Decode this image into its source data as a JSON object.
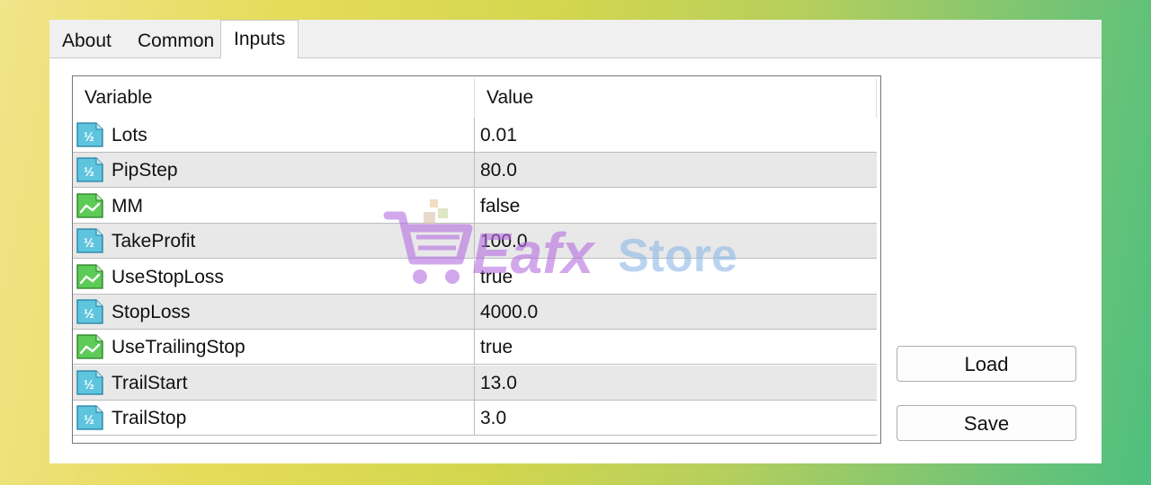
{
  "tabs": [
    {
      "label": "About"
    },
    {
      "label": "Common"
    },
    {
      "label": "Inputs"
    }
  ],
  "columns": {
    "variable": "Variable",
    "value": "Value"
  },
  "rows": [
    {
      "name": "Lots",
      "value": "0.01",
      "icon": "numeric-value-icon"
    },
    {
      "name": "PipStep",
      "value": "80.0",
      "icon": "numeric-value-icon"
    },
    {
      "name": "MM",
      "value": "false",
      "icon": "boolean-value-icon"
    },
    {
      "name": "TakeProfit",
      "value": "100.0",
      "icon": "numeric-value-icon"
    },
    {
      "name": "UseStopLoss",
      "value": "true",
      "icon": "boolean-value-icon"
    },
    {
      "name": "StopLoss",
      "value": "4000.0",
      "icon": "numeric-value-icon"
    },
    {
      "name": "UseTrailingStop",
      "value": "true",
      "icon": "boolean-value-icon"
    },
    {
      "name": "TrailStart",
      "value": "13.0",
      "icon": "numeric-value-icon"
    },
    {
      "name": "TrailStop",
      "value": "3.0",
      "icon": "numeric-value-icon"
    }
  ],
  "buttons": {
    "load": "Load",
    "save": "Save"
  },
  "watermark": {
    "part1": "Eafx",
    "part2": "Store"
  },
  "colors": {
    "numeric_icon": "#5fc4de",
    "boolean_icon": "#5ccb57",
    "watermark_purple": "#b56ee0",
    "watermark_blue": "#8db8e6"
  }
}
